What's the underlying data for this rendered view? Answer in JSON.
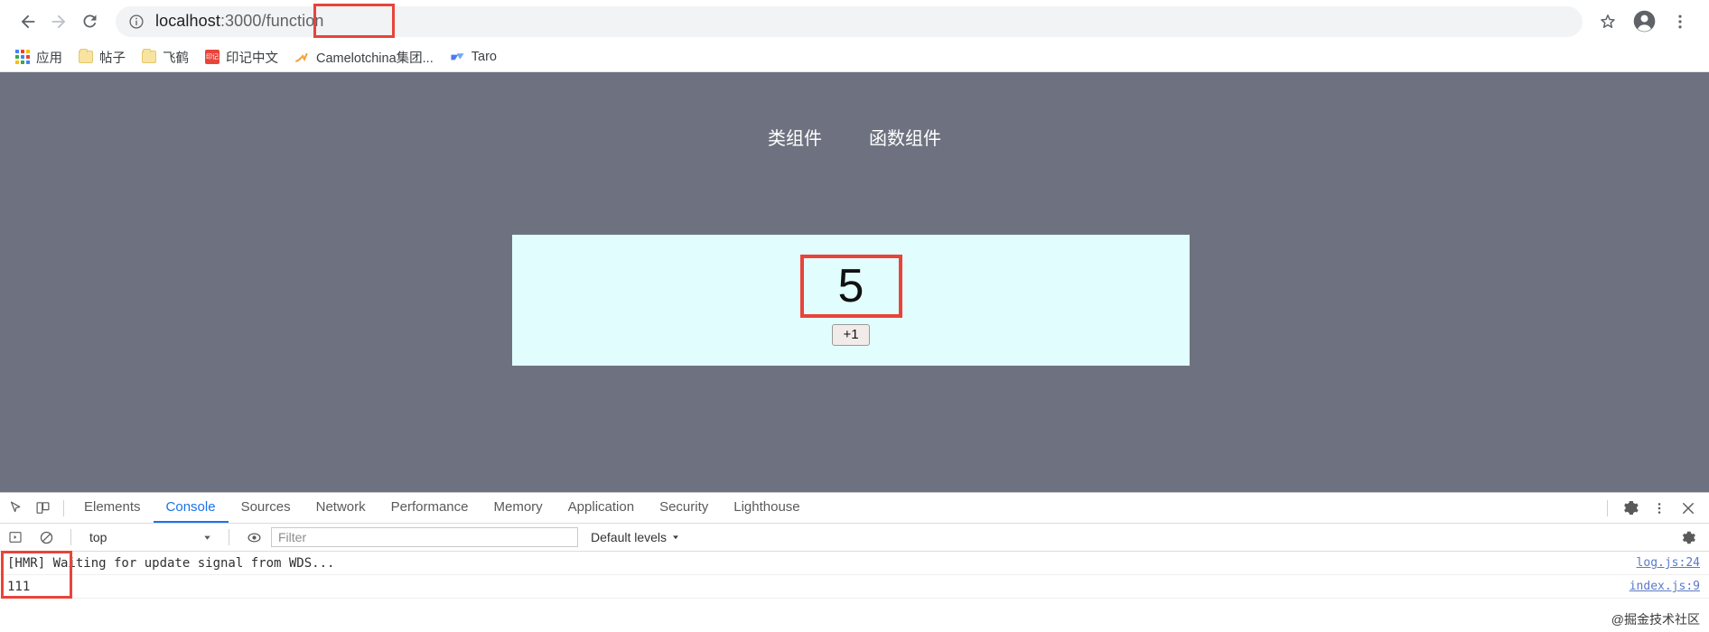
{
  "browser": {
    "back_icon": "arrow-left-icon",
    "forward_icon": "arrow-right-icon",
    "reload_icon": "reload-icon",
    "url": {
      "info_icon": "info-circle-icon",
      "host": "localhost",
      "rest": ":3000/function",
      "full": "localhost:3000/function",
      "highlight": "/function"
    },
    "star_icon": "star-icon",
    "profile_icon": "profile-avatar-icon",
    "menu_icon": "three-dot-menu-icon"
  },
  "bookmarks": [
    {
      "label": "应用",
      "icon": "apps-grid-icon"
    },
    {
      "label": "帖子",
      "icon": "folder-icon"
    },
    {
      "label": "飞鹤",
      "icon": "folder-icon"
    },
    {
      "label": "印记中文",
      "icon": "red-square-icon",
      "icon_text": "印记",
      "icon_color": "#e8443a"
    },
    {
      "label": "Camelotchina集团...",
      "icon": "orange-swoosh-icon"
    },
    {
      "label": "Taro",
      "icon": "taro-blue-icon"
    }
  ],
  "page": {
    "background_color": "#6e7280",
    "nav": [
      {
        "label": "类组件"
      },
      {
        "label": "函数组件"
      }
    ],
    "counter": {
      "card_color": "#e2fdfd",
      "value": "5",
      "increment_label": "+1",
      "annotation_color": "#e8443a"
    }
  },
  "devtools": {
    "inspect_icon": "inspect-cursor-icon",
    "device_icon": "device-toolbar-icon",
    "tabs": [
      {
        "label": "Elements",
        "active": false
      },
      {
        "label": "Console",
        "active": true
      },
      {
        "label": "Sources",
        "active": false
      },
      {
        "label": "Network",
        "active": false
      },
      {
        "label": "Performance",
        "active": false
      },
      {
        "label": "Memory",
        "active": false
      },
      {
        "label": "Application",
        "active": false
      },
      {
        "label": "Security",
        "active": false
      },
      {
        "label": "Lighthouse",
        "active": false
      }
    ],
    "tabbar_right": {
      "settings_icon": "gear-icon",
      "more_icon": "three-dot-menu-icon",
      "close_icon": "close-icon"
    },
    "console_toolbar": {
      "sidebar_icon": "console-sidebar-icon",
      "clear_icon": "clear-console-icon",
      "context": "top",
      "context_caret": "chevron-down-icon",
      "eye_icon": "live-expression-eye-icon",
      "filter_placeholder": "Filter",
      "filter_value": "",
      "levels_label": "Default levels",
      "levels_caret": "chevron-down-icon",
      "settings_icon": "gear-icon"
    },
    "messages": [
      {
        "text": "[HMR] Waiting for update signal from WDS...",
        "source": "log.js:24",
        "annotated": true
      },
      {
        "text": "111",
        "source": "index.js:9",
        "annotated": true
      }
    ],
    "accent_color": "#1a73e8"
  },
  "watermark": "@掘金技术社区"
}
